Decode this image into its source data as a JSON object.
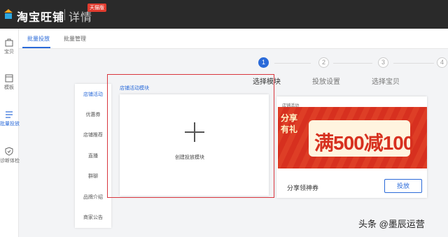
{
  "header": {
    "brand": "淘宝旺铺",
    "subtitle": "详情",
    "badge": "天猫版"
  },
  "sidebar": {
    "items": [
      {
        "label": "宝贝",
        "icon": "bag-icon"
      },
      {
        "label": "模板",
        "icon": "folder-icon"
      },
      {
        "label": "批量投放",
        "icon": "list-icon"
      },
      {
        "label": "诊断体检",
        "icon": "shield-icon"
      }
    ]
  },
  "tabs": {
    "items": [
      "批量投放",
      "批量管理"
    ]
  },
  "steps": {
    "items": [
      {
        "num": "1",
        "label": "选择模块"
      },
      {
        "num": "2",
        "label": "投放设置"
      },
      {
        "num": "3",
        "label": "选择宝贝"
      },
      {
        "num": "4",
        "label": ""
      }
    ]
  },
  "categories": {
    "items": [
      "店铺活动",
      "优惠券",
      "店铺推荐",
      "直播",
      "群聊",
      "品牌介绍",
      "商家公告"
    ]
  },
  "module": {
    "section_title": "店铺活动模块",
    "create_label": "创建投放模块"
  },
  "coupon": {
    "tag": "店铺活动",
    "share_line1": "分享",
    "share_line2": "有礼",
    "amount_text": "满500减100",
    "name": "分享领神券",
    "button": "投放"
  },
  "watermark": "头条 @墨辰运营",
  "colors": {
    "accent": "#2a6ad9",
    "highlight_border": "#d9363e",
    "banner": "#d7301f"
  }
}
